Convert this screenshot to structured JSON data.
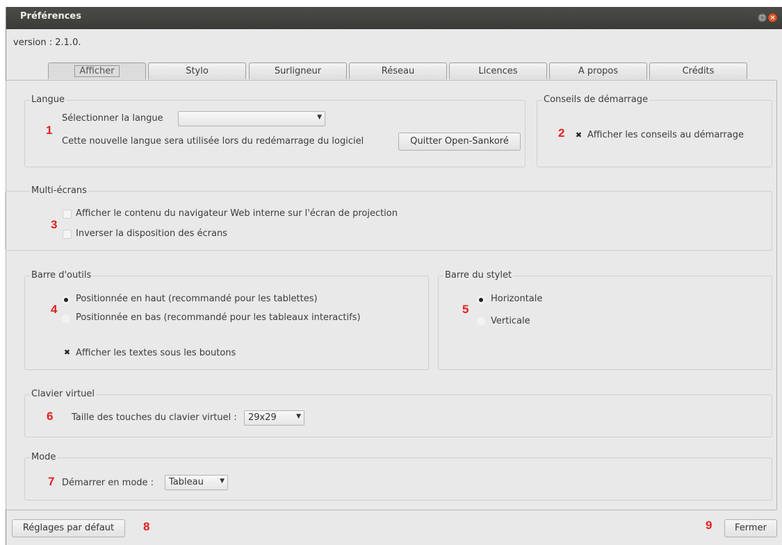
{
  "window": {
    "title": "Préférences"
  },
  "version": "version : 2.1.0.",
  "tabs": [
    "Afficher",
    "Stylo",
    "Surligneur",
    "Réseau",
    "Licences",
    "A propos",
    "Crédits"
  ],
  "langue": {
    "group_title": "Langue",
    "select_label": "Sélectionner la langue",
    "select_value": "",
    "restart_note": "Cette nouvelle langue sera utilisée lors du redémarrage du logiciel",
    "quit_button": "Quitter Open-Sankoré",
    "marker": "1"
  },
  "conseils": {
    "group_title": "Conseils de démarrage",
    "checkbox_label": "Afficher les conseils au démarrage",
    "checked": true,
    "marker": "2"
  },
  "multi_ecrans": {
    "group_title": "Multi-écrans",
    "option1": "Afficher le contenu du navigateur Web interne sur l'écran de projection",
    "option2": "Inverser la disposition des écrans",
    "marker": "3"
  },
  "barre_outils": {
    "group_title": "Barre d'outils",
    "radio_top": "Positionnée en haut (recommandé pour les tablettes)",
    "radio_bottom": "Positionnée en bas (recommandé pour les tableaux interactifs)",
    "show_texts": "Afficher les textes sous les boutons",
    "marker": "4"
  },
  "barre_stylet": {
    "group_title": "Barre du stylet",
    "horizontal": "Horizontale",
    "vertical": "Verticale",
    "marker": "5"
  },
  "clavier": {
    "group_title": "Clavier virtuel",
    "label": "Taille des touches du clavier virtuel :",
    "value": "29x29",
    "marker": "6"
  },
  "mode": {
    "group_title": "Mode",
    "label": "Démarrer en mode :",
    "value": "Tableau",
    "marker": "7"
  },
  "footer": {
    "defaults_button": "Réglages par défaut",
    "marker_defaults": "8",
    "marker_close": "9",
    "close_button": "Fermer"
  },
  "icons": {
    "dropdown": "chevron-down-icon",
    "checked": "checkmark-icon"
  }
}
